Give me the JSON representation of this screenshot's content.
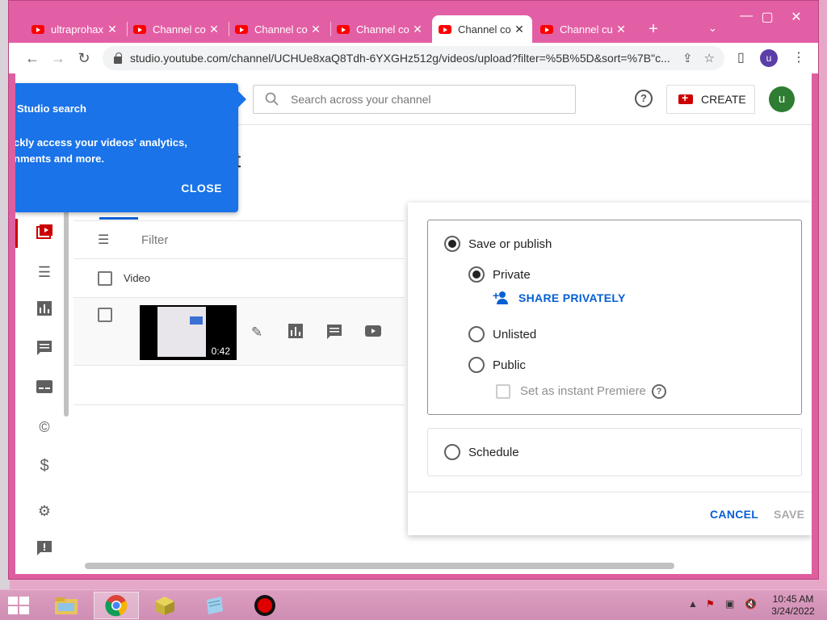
{
  "browser": {
    "tabs": [
      {
        "label": "ultraprohax",
        "active": false
      },
      {
        "label": "Channel co",
        "active": false
      },
      {
        "label": "Channel co",
        "active": false
      },
      {
        "label": "Channel co",
        "active": false
      },
      {
        "label": "Channel co",
        "active": true
      },
      {
        "label": "Channel cu",
        "active": false
      }
    ],
    "url": "studio.youtube.com/channel/UCHUe8xaQ8Tdh-6YXGHz512g/videos/upload?filter=%5B%5D&sort=%7B\"c...",
    "profile_initial": "u"
  },
  "studio": {
    "search_placeholder": "Search across your channel",
    "create_label": "CREATE",
    "avatar_initial": "u",
    "title_fragment": "t",
    "filter_placeholder": "Filter",
    "table_header_video": "Video",
    "video_duration": "0:42"
  },
  "tooltip": {
    "title": "Studio search",
    "line1": "ckly access your videos' analytics,",
    "line2": "nments and more.",
    "close_label": "CLOSE"
  },
  "visibility": {
    "save_or_publish": "Save or publish",
    "private": "Private",
    "share_privately": "SHARE PRIVATELY",
    "unlisted": "Unlisted",
    "public": "Public",
    "instant_premiere": "Set as instant Premiere",
    "schedule": "Schedule",
    "cancel": "CANCEL",
    "save": "SAVE",
    "selected": "Private"
  },
  "taskbar": {
    "time": "10:45 AM",
    "date": "3/24/2022"
  },
  "colors": {
    "accent_blue": "#065fd4",
    "tooltip_blue": "#1a73e8",
    "youtube_red": "#ff0000",
    "tabstrip_pink": "#e35fa5"
  }
}
